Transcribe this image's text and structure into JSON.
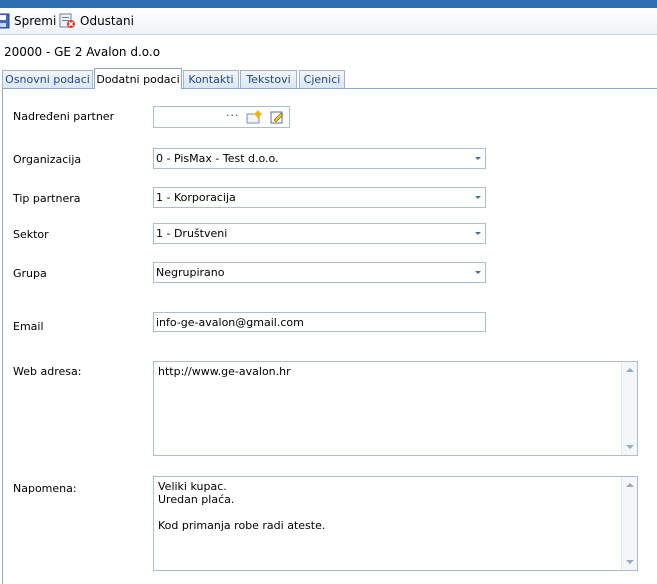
{
  "toolbar": {
    "save_label": "Spremi",
    "cancel_label": "Odustani",
    "save_icon": "floppy-disk-icon",
    "cancel_icon": "cancel-document-icon"
  },
  "record_title": "20000 - GE 2 Avalon d.o.o",
  "tabs": [
    {
      "label": "Osnovni podaci",
      "active": false
    },
    {
      "label": "Dodatni podaci",
      "active": true
    },
    {
      "label": "Kontakti",
      "active": false
    },
    {
      "label": "Tekstovi",
      "active": false
    },
    {
      "label": "Cjenici",
      "active": false
    }
  ],
  "form": {
    "parent_partner": {
      "label": "Nadređeni partner",
      "value": "",
      "button_text": "···"
    },
    "organization": {
      "label": "Organizacija",
      "value": "0 - PisMax - Test d.o.o."
    },
    "partner_type": {
      "label": "Tip partnera",
      "value": "1 - Korporacija"
    },
    "sector": {
      "label": "Sektor",
      "value": "1 - Društveni"
    },
    "group": {
      "label": "Grupa",
      "value": "Negrupirano"
    },
    "email": {
      "label": "Email",
      "value": "info-ge-avalon@gmail.com"
    },
    "web": {
      "label": "Web adresa:",
      "value": "http://www.ge-avalon.hr"
    },
    "note": {
      "label": "Napomena:",
      "value": "Veliki kupac.\nUredan plaća.\n\nKod primanja robe radi ateste."
    }
  },
  "colors": {
    "accent": "#2e6fb0",
    "tab_text": "#1c4a86",
    "border": "#a9bdd6"
  }
}
